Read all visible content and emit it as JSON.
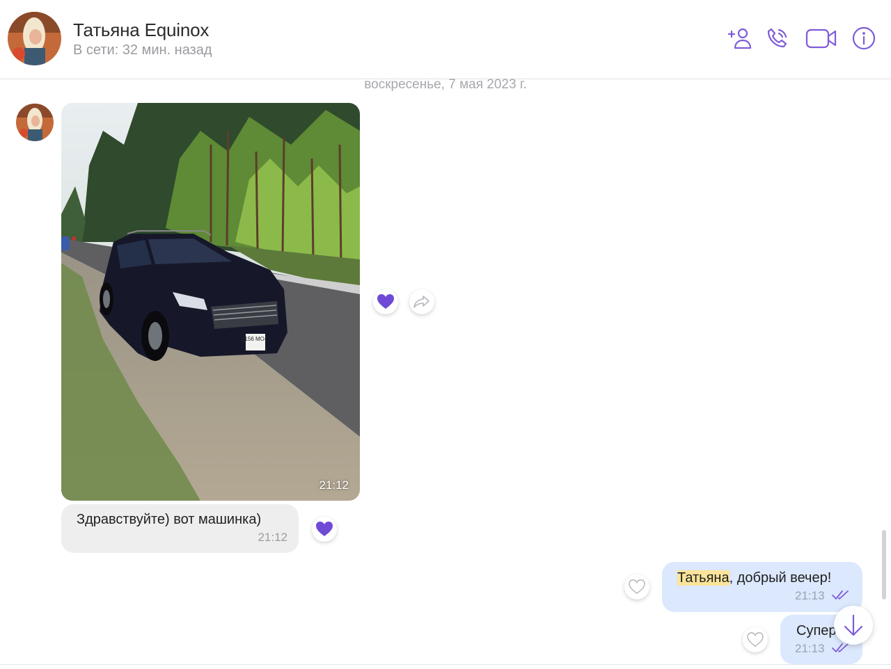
{
  "header": {
    "contact_name": "Татьяна Equinox",
    "status": "В сети: 32 мин. назад",
    "actions": [
      {
        "icon": "add-contact-icon"
      },
      {
        "icon": "phone-icon"
      },
      {
        "icon": "video-camera-icon"
      },
      {
        "icon": "info-icon"
      }
    ]
  },
  "date_separator": "воскресенье, 7 мая 2023 г.",
  "messages": [
    {
      "type": "photo",
      "direction": "incoming",
      "time": "21:12",
      "plate_text": "2156 MO-7",
      "liked": true
    },
    {
      "type": "text",
      "direction": "incoming",
      "text": "Здравствуйте) вот машинка)",
      "time": "21:12",
      "liked": true
    },
    {
      "type": "text",
      "direction": "outgoing",
      "highlight": "Татьяна",
      "text_rest": ", добрый вечер!",
      "time": "21:13",
      "liked": false
    },
    {
      "type": "text",
      "direction": "outgoing",
      "text": "Супер",
      "time": "21:13",
      "liked": false
    }
  ],
  "colors": {
    "accent": "#7f5bd9",
    "incoming_bubble": "#eeeeef",
    "outgoing_bubble": "#dbe8fd",
    "highlight": "#fbe49a"
  }
}
